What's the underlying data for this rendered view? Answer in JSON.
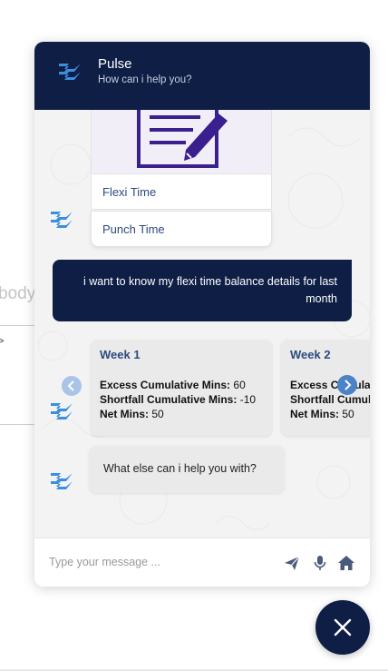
{
  "background": {
    "partial_text": "body",
    "partial_link": ">"
  },
  "header": {
    "title": "Pulse",
    "subtitle": "How can i help you?"
  },
  "chat": {
    "card_buttons": [
      "Flexi Time",
      "Punch Time"
    ],
    "user_message": "i want to know my flexi time balance details for last month",
    "weeks": [
      {
        "title": "Week 1",
        "rows": [
          {
            "label": "Excess Cumulative Mins:",
            "value": "60"
          },
          {
            "label": "Shortfall Cumulative Mins:",
            "value": "-10"
          },
          {
            "label": "Net Mins:",
            "value": "50"
          }
        ]
      },
      {
        "title": "Week 2",
        "rows": [
          {
            "label": "Excess Cumulative Mins:",
            "value": ""
          },
          {
            "label": "Shortfall Cumulative Mins:",
            "value": ""
          },
          {
            "label": "Net Mins:",
            "value": "50"
          }
        ]
      }
    ],
    "bot_message": "What else can i help you with?"
  },
  "composer": {
    "placeholder": "Type your message ..."
  },
  "colors": {
    "navy": "#0e1e45",
    "accent": "#2c4a7d",
    "logo_blue": "#3a8fe0",
    "purple": "#3a1f8f"
  },
  "icons": [
    "pulse-logo-icon",
    "notepad-pencil-icon",
    "chevron-left-icon",
    "chevron-right-icon",
    "send-icon",
    "mic-icon",
    "home-icon",
    "close-icon"
  ]
}
